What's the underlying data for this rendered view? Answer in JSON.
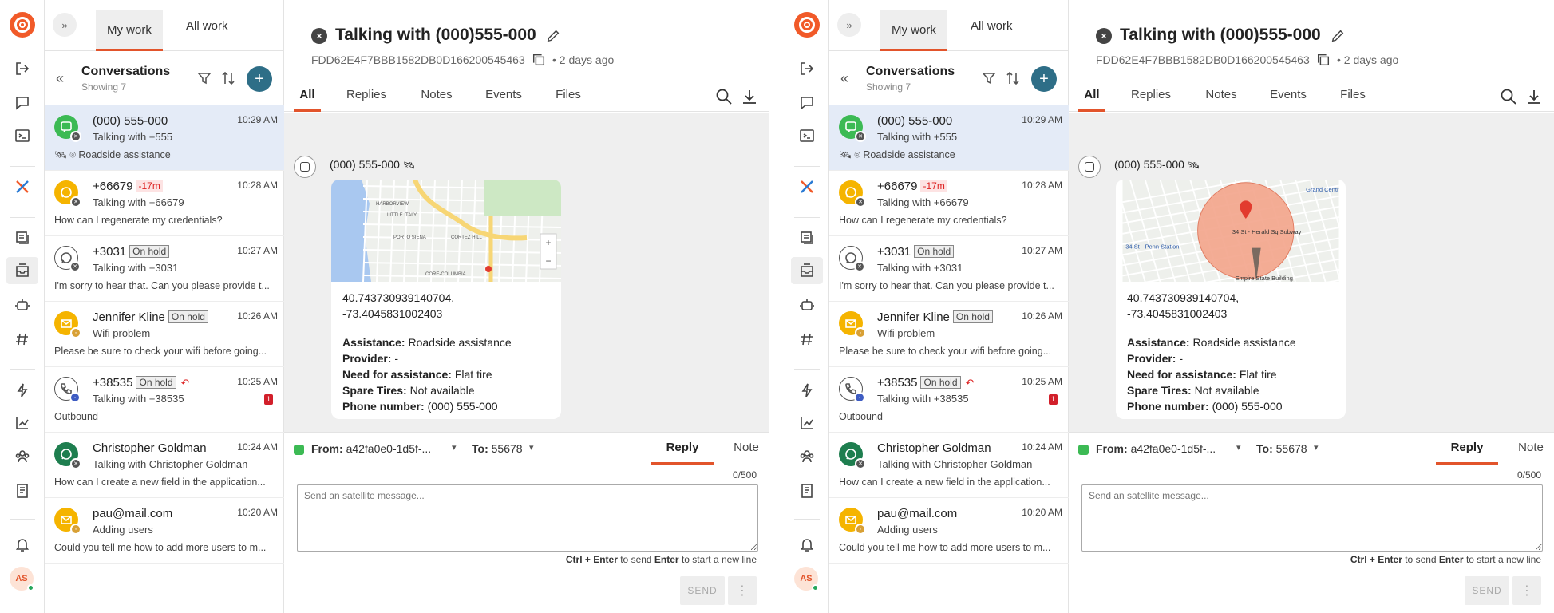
{
  "colors": {
    "accent": "#e2542b",
    "brand": "#f15a29",
    "add_button": "#2e6e87",
    "selected_row": "#e4ebf7",
    "thread_bg": "#efefef"
  },
  "rail": {
    "icons": [
      "logo-icon",
      "logout-icon",
      "chat-bubble-icon",
      "terminal-icon",
      "integration-icon",
      "knowledge-icon",
      "inbox-icon",
      "bot-icon",
      "hashtag-icon",
      "automation-icon",
      "analytics-icon",
      "team-icon",
      "contacts-book-icon",
      "bell-icon"
    ],
    "avatar_initials": "AS"
  },
  "nav": {
    "tabs": [
      {
        "label": "My work"
      },
      {
        "label": "All work"
      }
    ]
  },
  "conversations": {
    "title": "Conversations",
    "showing": "Showing 7"
  },
  "rows": [
    {
      "name": "(000) 555-000",
      "time": "10:29 AM",
      "sub": "Talking with +555",
      "preview": "Roadside assistance",
      "channel": "sms"
    },
    {
      "name": "+66679",
      "late": "-17m",
      "time": "10:28 AM",
      "sub": "Talking with +66679",
      "preview": "How can I regenerate my credentials?",
      "channel": "whatsapp"
    },
    {
      "name": "+3031",
      "hold": "On hold",
      "time": "10:27 AM",
      "sub": "Talking with +3031",
      "preview": "I'm sorry to hear that. Can you please provide t...",
      "channel": "whatsapp"
    },
    {
      "name": "Jennifer Kline",
      "hold": "On hold",
      "time": "10:26 AM",
      "sub": "Wifi problem",
      "preview": "Please be sure to check your wifi before going...",
      "channel": "email"
    },
    {
      "name": "+38535",
      "hold": "On hold",
      "time": "10:25 AM",
      "sub": "Talking with +38535",
      "preview": "Outbound",
      "count": "1",
      "channel": "phone"
    },
    {
      "name": "Christopher Goldman",
      "time": "10:24 AM",
      "sub": "Talking with Christopher Goldman",
      "preview": "How can I create a new field in the application...",
      "channel": "whatsapp"
    },
    {
      "name": "pau@mail.com",
      "time": "10:20 AM",
      "sub": "Adding users",
      "preview": "Could you tell me how to add more users to m...",
      "channel": "email"
    }
  ],
  "main": {
    "title": "Talking with (000)555-000",
    "id": "FDD62E4F7BBB1582DB0D166200545463",
    "ago": "• 2 days ago",
    "tabs": [
      {
        "label": "All"
      },
      {
        "label": "Replies"
      },
      {
        "label": "Notes"
      },
      {
        "label": "Events"
      },
      {
        "label": "Files"
      }
    ]
  },
  "message": {
    "from": "(000) 555-000",
    "coords_line1": "40.743730939140704,",
    "coords_line2": "-73.4045831002403",
    "fields": [
      {
        "label": "Assistance:",
        "value": "Roadside assistance"
      },
      {
        "label": "Provider:",
        "value": "-"
      },
      {
        "label": "Need for assistance:",
        "value": "Flat tire"
      },
      {
        "label": "Spare Tires:",
        "value": "Not available"
      },
      {
        "label": "Phone number:",
        "value": "(000) 555-000"
      }
    ],
    "map_left_labels": [
      "HARBORVIEW",
      "LITTLE ITALY",
      "PORTO SIENA",
      "CORTEZ HILL",
      "CORE-COLUMBIA"
    ],
    "map_right_labels": [
      "34 St - Herald Sq Subway",
      "34 St - Penn Station",
      "Empire State Building",
      "Grand Centr"
    ]
  },
  "composer": {
    "from_label": "From:",
    "from_value": "a42fa0e0-1d5f-...",
    "to_label": "To:",
    "to_value": "55678",
    "tabs": [
      {
        "label": "Reply"
      },
      {
        "label": "Note"
      }
    ],
    "counter": "0/500",
    "placeholder": "Send an satellite message...",
    "shortcut_key1": "Ctrl + Enter",
    "shortcut_text1": " to send ",
    "shortcut_key2": "Enter",
    "shortcut_text2": " to start a new line",
    "send_label": "SEND",
    "more_label": "⋮"
  }
}
